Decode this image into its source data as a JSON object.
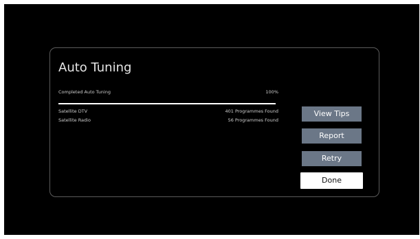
{
  "dialog": {
    "title": "Auto Tuning",
    "status_label": "Completed Auto Tuning",
    "progress_text": "100%",
    "progress": 1.0,
    "results": [
      {
        "label": "Satellite DTV",
        "value": "401 Programmes Found"
      },
      {
        "label": "Satellite Radio",
        "value": "56 Programmes Found"
      }
    ],
    "buttons": {
      "view_tips": "View Tips",
      "report": "Report",
      "retry": "Retry",
      "done": "Done"
    }
  },
  "colors": {
    "background": "#000000",
    "button": "#6b7787",
    "focused_button": "#ffffff",
    "progress": "#ffffff"
  }
}
